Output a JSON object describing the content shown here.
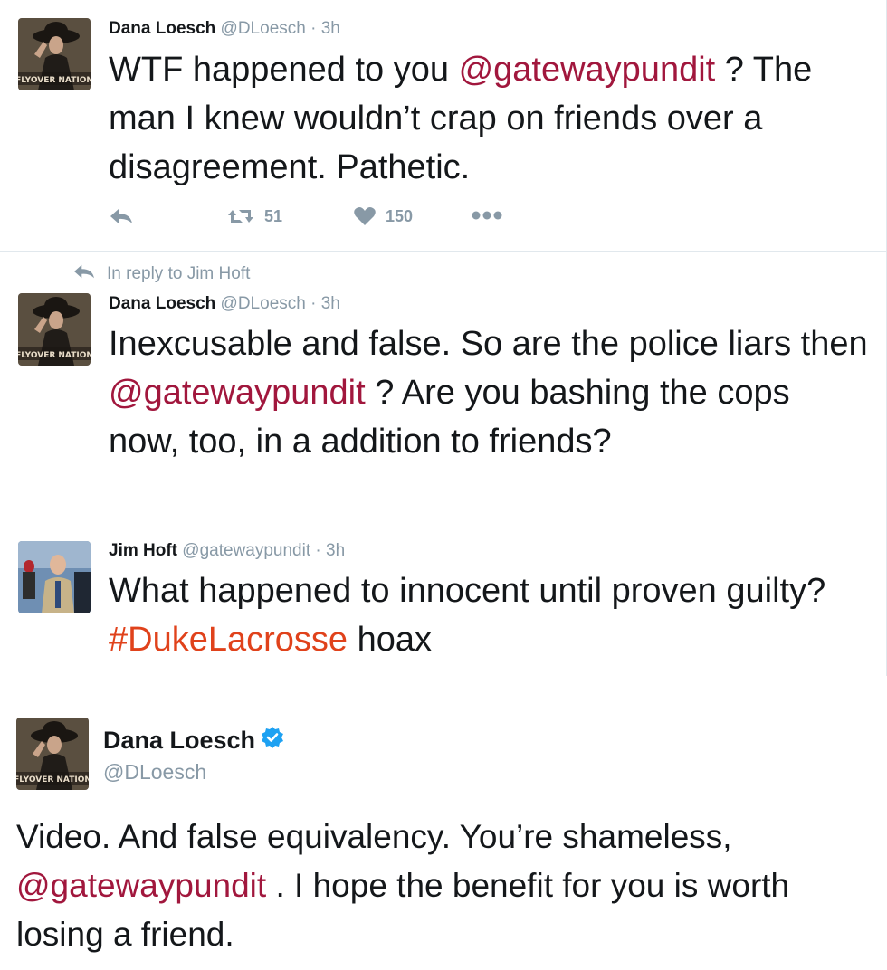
{
  "tweet1": {
    "name": "Dana Loesch",
    "handle": "@DLoesch",
    "sep": "·",
    "time": "3h",
    "avatar_label": "FLYOVER NATION",
    "text_before": "WTF happened to you ",
    "mention": "@gatewaypundit",
    "text_after": " ? The man I knew wouldn’t crap on friends over a disagreement. Pathetic.",
    "retweets": "51",
    "likes": "150"
  },
  "reply_context": {
    "text": "In reply to Jim Hoft"
  },
  "tweet2": {
    "name": "Dana Loesch",
    "handle": "@DLoesch",
    "sep": "·",
    "time": "3h",
    "avatar_label": "FLYOVER NATION",
    "text_before": "Inexcusable and false. So are the police liars then ",
    "mention": "@gatewaypundit",
    "text_after": " ? Are you bashing the cops now, too, in a addition to friends?"
  },
  "tweet3": {
    "name": "Jim Hoft",
    "handle": "@gatewaypundit",
    "sep": "·",
    "time": "3h",
    "text_before": "What happened to innocent until proven guilty? ",
    "hashtag": "#DukeLacrosse",
    "text_after": " hoax"
  },
  "tweet4": {
    "name": "Dana Loesch",
    "handle": "@DLoesch",
    "avatar_label": "FLYOVER NATION",
    "text_before": "Video. And false equivalency. You’re shameless, ",
    "mention": "@gatewaypundit",
    "text_after": " . I hope the benefit for you is worth losing a friend."
  },
  "colors": {
    "mention": "#a1173d",
    "hashtag": "#e0421b",
    "muted": "#8899a6",
    "verified": "#1da1f2"
  },
  "icons": [
    "reply-icon",
    "retweet-icon",
    "heart-icon",
    "more-icon",
    "verified-badge-icon"
  ]
}
